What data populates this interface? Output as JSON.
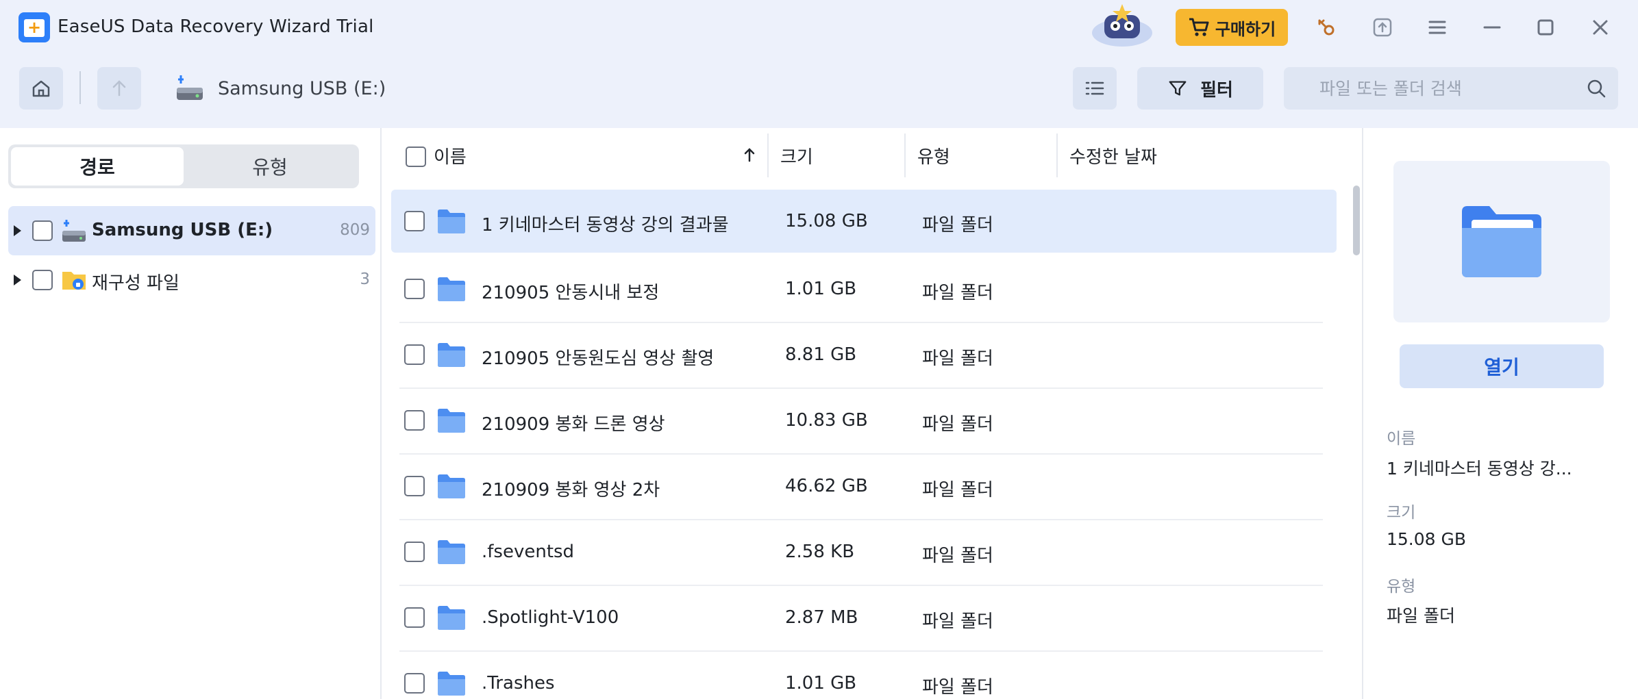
{
  "window": {
    "title": "EaseUS Data Recovery Wizard Trial",
    "buy_label": "구매하기"
  },
  "nav": {
    "breadcrumb": "Samsung USB (E:)",
    "filter_label": "필터",
    "search_placeholder": "파일 또는 폴더 검색"
  },
  "left": {
    "tabs": [
      {
        "label": "경로",
        "active": true
      },
      {
        "label": "유형",
        "active": false
      }
    ],
    "tree": [
      {
        "label": "Samsung USB (E:)",
        "count": "809",
        "selected": true
      },
      {
        "label": "재구성 파일",
        "count": "3",
        "selected": false
      }
    ]
  },
  "table": {
    "columns": [
      "이름",
      "크기",
      "유형",
      "수정한 날짜"
    ],
    "rows": [
      {
        "name": "1 키네마스터 동영상 강의 결과물",
        "size": "15.08 GB",
        "type": "파일 폴더"
      },
      {
        "name": "210905 안동시내 보정",
        "size": "1.01 GB",
        "type": "파일 폴더"
      },
      {
        "name": "210905 안동원도심 영상 촬영",
        "size": "8.81 GB",
        "type": "파일 폴더"
      },
      {
        "name": "210909 봉화 드론 영상",
        "size": "10.83 GB",
        "type": "파일 폴더"
      },
      {
        "name": "210909 봉화 영상 2차",
        "size": "46.62 GB",
        "type": "파일 폴더"
      },
      {
        "name": ".fseventsd",
        "size": "2.58 KB",
        "type": "파일 폴더"
      },
      {
        "name": ".Spotlight-V100",
        "size": "2.87 MB",
        "type": "파일 폴더"
      },
      {
        "name": ".Trashes",
        "size": "1.01 GB",
        "type": "파일 폴더"
      }
    ]
  },
  "details": {
    "open_label": "열기",
    "name_label": "이름",
    "name_value": "1 키네마스터 동영상 강...",
    "size_label": "크기",
    "size_value": "15.08 GB",
    "type_label": "유형",
    "type_value": "파일 폴더"
  },
  "colors": {
    "accent": "#2d7ff9",
    "buy": "#f7b730",
    "folder": "#6aa5f5",
    "selected_row": "#e1ebfc"
  }
}
